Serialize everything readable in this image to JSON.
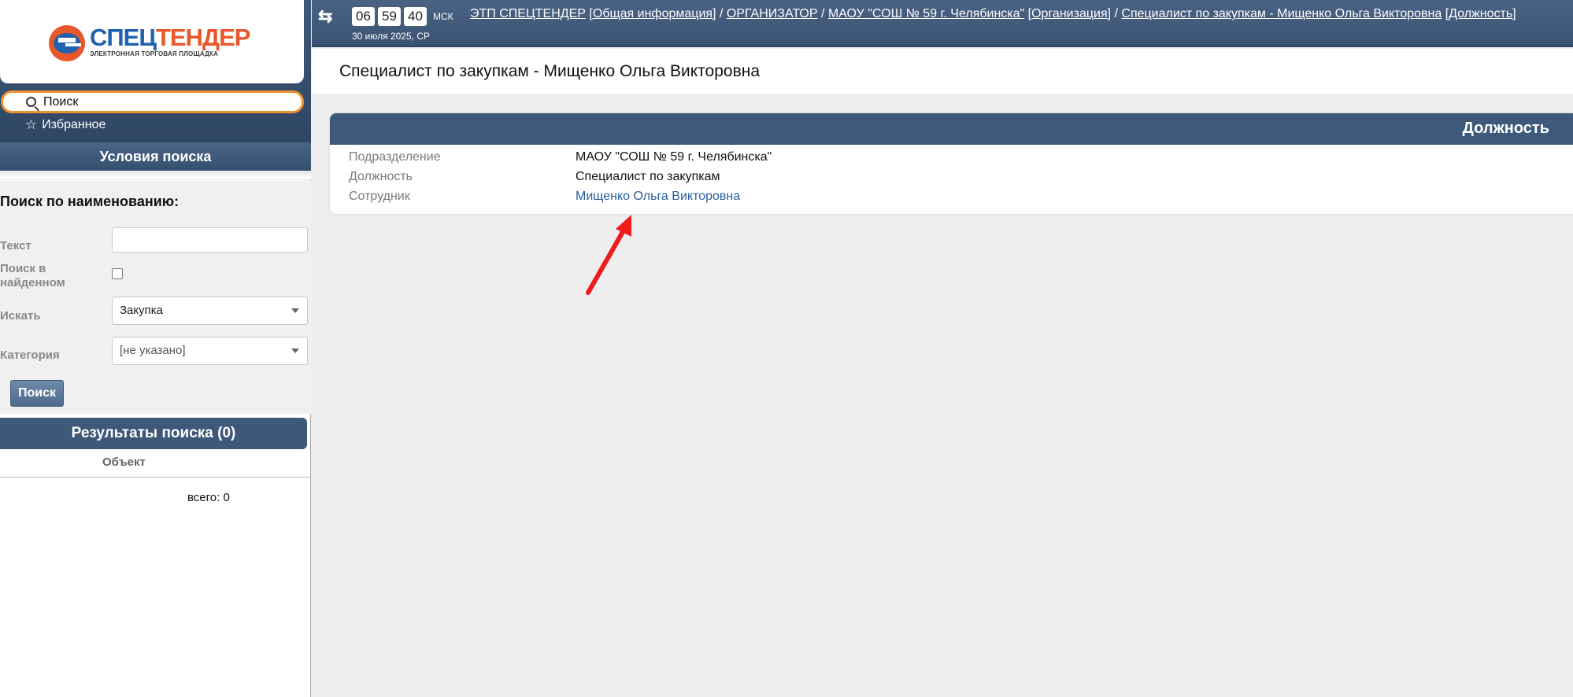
{
  "logo": {
    "word1": "СПЕЦ",
    "word2": "ТЕНДЕР",
    "subtitle": "ЭЛЕКТРОННАЯ ТОРГОВАЯ ПЛОЩАДКА"
  },
  "sidebar": {
    "search_label": "Поиск",
    "favorites_label": "Избранное",
    "conditions_header": "Условия поиска",
    "form_title": "Поиск по наименованию:",
    "text_label": "Текст",
    "text_value": "",
    "search_in_found_label_1": "Поиск в",
    "search_in_found_label_2": "найденном",
    "search_in_found_checked": false,
    "search_for_label": "Искать",
    "search_for_value": "Закупка",
    "category_label": "Категория",
    "category_value": "[не указано]",
    "search_button": "Поиск",
    "results_header": "Результаты поиска (0)",
    "results_column": "Объект",
    "total": "всего: 0"
  },
  "topbar": {
    "clock": {
      "hours": "06",
      "minutes": "59",
      "seconds": "40",
      "tz": "МСК"
    },
    "date": "30 июля 2025, СР",
    "breadcrumb": {
      "etp": "ЭТП СПЕЦТЕНДЕР",
      "etp_type": "[Общая информация]",
      "sep1": " / ",
      "organizer": "ОРГАНИЗАТОР",
      "sep2": " / ",
      "org": "МАОУ \"СОШ № 59 г. Челябинска\"",
      "org_type": "[Организация]",
      "sep3": " / ",
      "person": "Специалист по закупкам - Мищенко Ольга Викторовна",
      "person_type": "[Должность]"
    }
  },
  "main": {
    "page_title": "Специалист по закупкам - Мищенко Ольга Викторовна",
    "card_title": "Должность",
    "rows": [
      {
        "key": "Подразделение",
        "value": "МАОУ \"СОШ № 59 г. Челябинска\""
      },
      {
        "key": "Должность",
        "value": "Специалист по закупкам"
      },
      {
        "key": "Сотрудник",
        "value": "Мищенко Ольга Викторовна"
      }
    ]
  },
  "colors": {
    "header_blue": "#3e5a7a",
    "accent_orange": "#f0902f",
    "link_blue": "#2a5e9e",
    "arrow_red": "#ee1c1c"
  }
}
